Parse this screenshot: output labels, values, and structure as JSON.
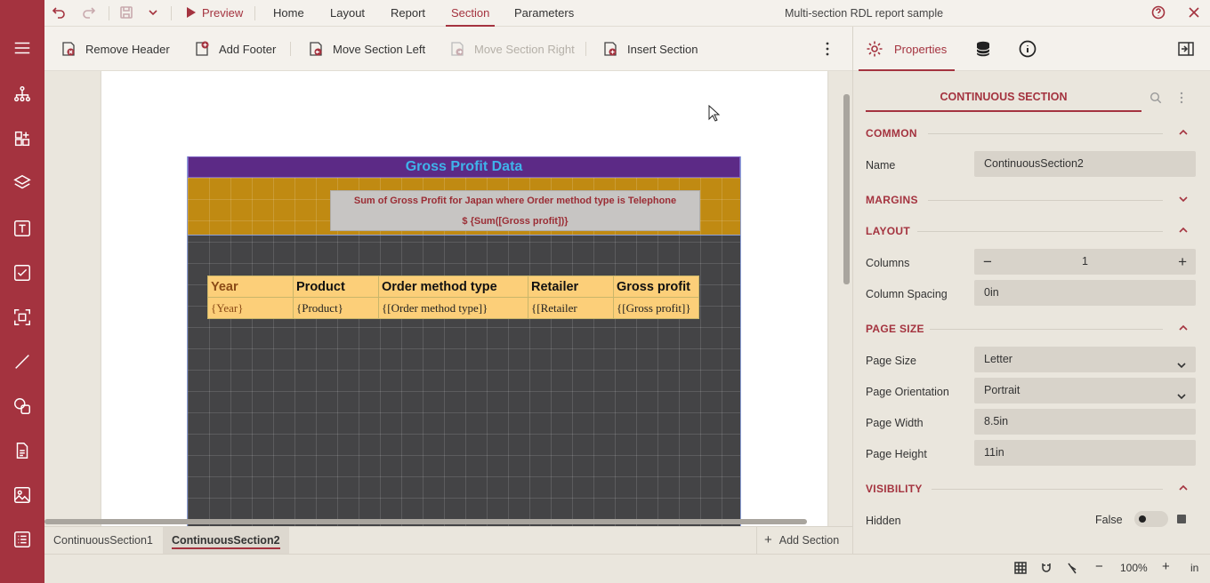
{
  "app": {
    "title": "Multi-section RDL report sample",
    "menu": {
      "preview": "Preview",
      "home": "Home",
      "layout": "Layout",
      "report": "Report",
      "section": "Section",
      "parameters": "Parameters"
    }
  },
  "toolbar": {
    "remove_header": "Remove Header",
    "add_footer": "Add Footer",
    "move_left": "Move Section Left",
    "move_right": "Move Section Right",
    "insert_section": "Insert Section"
  },
  "report": {
    "title": "Gross Profit Data",
    "summary_line1": "Sum of Gross Profit for Japan where Order method type is Telephone",
    "summary_line2": "$ {Sum([Gross profit])}",
    "table": {
      "headers": [
        "Year",
        "Product",
        "Order method type",
        "Retailer",
        "Gross profit"
      ],
      "row": [
        "{Year}",
        "{Product}",
        "{[Order method type]}",
        "{[Retailer",
        "{[Gross profit]}"
      ]
    }
  },
  "sections": {
    "tabs": [
      "ContinuousSection1",
      "ContinuousSection2"
    ],
    "active": "ContinuousSection2",
    "add_label": "Add Section"
  },
  "status": {
    "zoom": "100%",
    "unit": "in"
  },
  "properties": {
    "tab_label": "Properties",
    "section_title": "CONTINUOUS SECTION",
    "groups": {
      "common": "COMMON",
      "margins": "MARGINS",
      "layout": "LAYOUT",
      "page_size": "PAGE SIZE",
      "visibility": "VISIBILITY"
    },
    "name_label": "Name",
    "name_value": "ContinuousSection2",
    "columns_label": "Columns",
    "columns_value": "1",
    "spacing_label": "Column Spacing",
    "spacing_value": "0in",
    "page_size_label": "Page Size",
    "page_size_value": "Letter",
    "orientation_label": "Page Orientation",
    "orientation_value": "Portrait",
    "width_label": "Page Width",
    "width_value": "8.5in",
    "height_label": "Page Height",
    "height_value": "11in",
    "hidden_label": "Hidden",
    "hidden_value": "False"
  },
  "colors": {
    "accent": "#a4333f",
    "title_band": "#5c2a86",
    "header_band": "#c08a12",
    "table_fill": "#fccf79"
  }
}
